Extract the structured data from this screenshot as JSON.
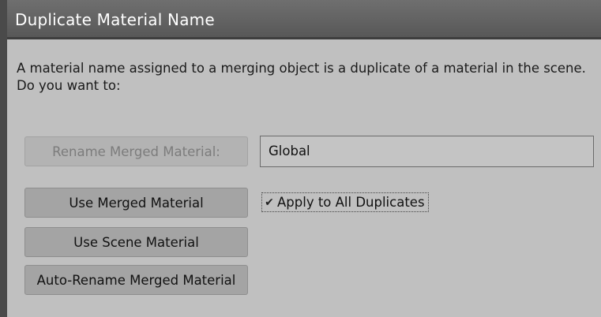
{
  "dialog": {
    "title": "Duplicate Material Name",
    "message_line1": "A material name assigned to a merging object is a duplicate of a material in the scene.",
    "message_line2": "Do you want to:"
  },
  "buttons": {
    "rename_merged": "Rename Merged Material:",
    "use_merged": "Use Merged Material",
    "use_scene": "Use Scene Material",
    "auto_rename": "Auto-Rename Merged Material"
  },
  "rename_field": {
    "value": "Global"
  },
  "apply_all": {
    "label": "Apply to All Duplicates",
    "checked": true,
    "glyph": "✔"
  }
}
